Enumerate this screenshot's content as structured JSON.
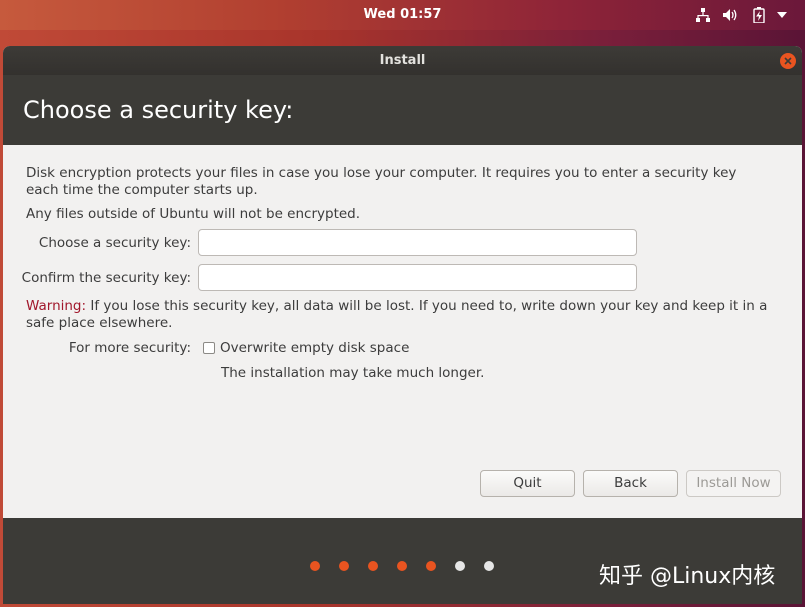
{
  "topbar": {
    "clock": "Wed 01:57",
    "icons": [
      "network-icon",
      "volume-icon",
      "battery-icon",
      "menu-arrow-icon"
    ]
  },
  "window": {
    "title": "Install",
    "close_icon": "close-icon",
    "page_title": "Choose a security key:"
  },
  "content": {
    "description": "Disk encryption protects your files in case you lose your computer. It requires you to enter a security key each time the computer starts up.",
    "notice": "Any files outside of Ubuntu will not be encrypted.",
    "key_label": "Choose a security key:",
    "key_value": "",
    "confirm_label": "Confirm the security key:",
    "confirm_value": "",
    "warning_word": "Warning:",
    "warning_text": " If you lose this security key, all data will be lost. If you need to, write down your key and keep it in a safe place elsewhere.",
    "security_label": "For more security:",
    "overwrite_label": "Overwrite empty disk space",
    "overwrite_checked": false,
    "overwrite_note": "The installation may take much longer."
  },
  "buttons": {
    "quit": "Quit",
    "back": "Back",
    "install_now": "Install Now"
  },
  "progress": {
    "total_steps": 7,
    "completed_steps": 5,
    "active_color": "#e95420",
    "inactive_color": "#e6e6e6"
  },
  "watermark": "知乎 @Linux内核"
}
